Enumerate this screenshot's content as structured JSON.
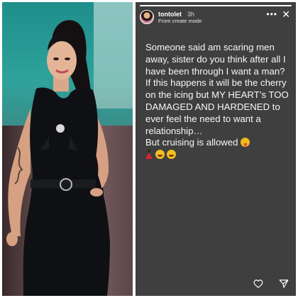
{
  "story": {
    "username": "tontolet",
    "time": "3h",
    "subtitle": "From create mode",
    "progress": 1.0,
    "menu_icon": "more-horizontal-icon",
    "close_icon": "close-icon",
    "lines": [
      "Someone said am scaring men away, sister do you think after all I have been through I want a man?",
      "If this happens it will be the cherry on the icing but MY HEART’s  TOO DAMAGED AND HARDENED to ever feel the need to want a relationship…",
      "But cruising is allowed"
    ],
    "emojis": [
      "face-with-tongue-emoji",
      "dancer-emoji",
      "hugging-face-emoji",
      "hugging-face-emoji"
    ],
    "footer_icons": [
      "heart-icon",
      "send-icon"
    ]
  },
  "colors": {
    "story_background": "#3f3f3f",
    "text": "#f7f7f7",
    "photo_backdrop_teal": "#2e8f8c",
    "dress": "#0f1014"
  }
}
